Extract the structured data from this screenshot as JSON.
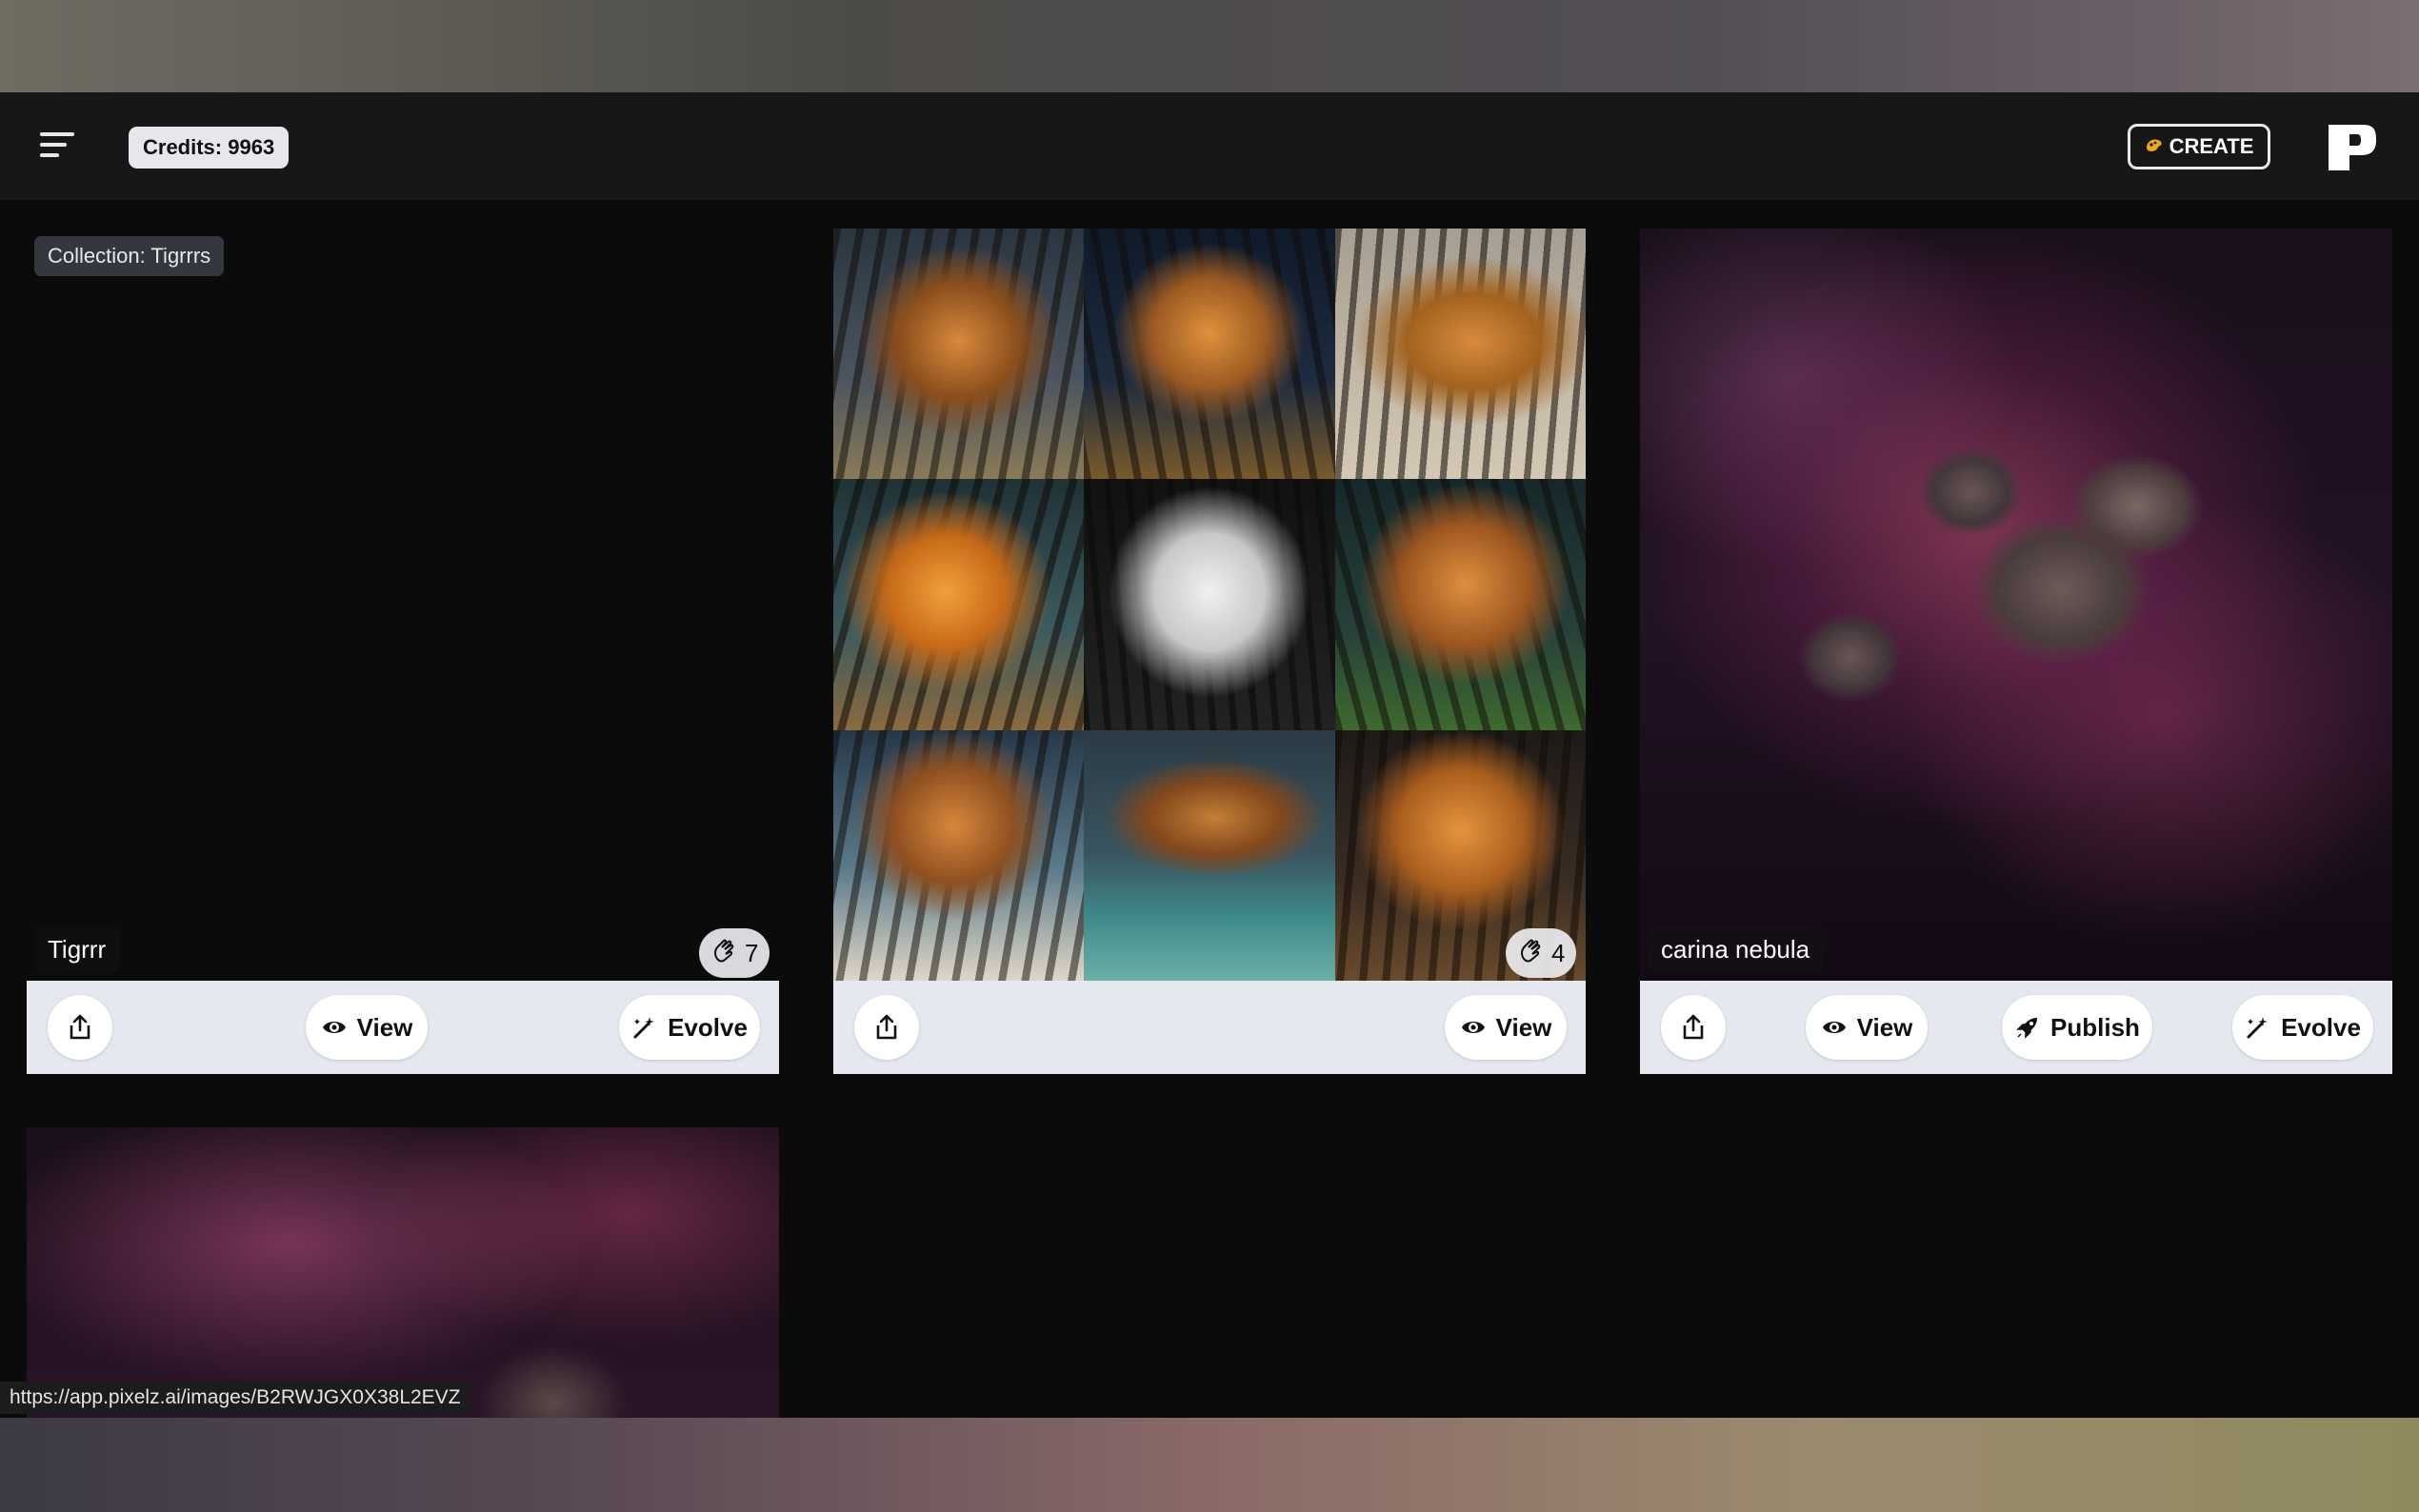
{
  "header": {
    "credits": "Credits: 9963",
    "create_label": "CREATE"
  },
  "cards": [
    {
      "collection_tag": "Collection: Tigrrrs",
      "title": "Tigrrr",
      "likes": "7",
      "actions": {
        "view": "View",
        "evolve": "Evolve"
      }
    },
    {
      "likes": "4",
      "actions": {
        "view": "View"
      }
    },
    {
      "title": "carina nebula",
      "actions": {
        "view": "View",
        "publish": "Publish",
        "evolve": "Evolve"
      }
    }
  ],
  "status_bar": {
    "url": "https://app.pixelz.ai/images/B2RWJGX0X38L2EVZ"
  },
  "colors": {
    "topbar": "#171718",
    "card_bar": "#e5e9ef",
    "create_icon": "#f0a81c"
  },
  "icons": [
    "menu-icon",
    "share-icon",
    "eye-icon",
    "magic-wand-icon",
    "rocket-icon",
    "clap-icon",
    "paint-icon",
    "logo-p-icon"
  ]
}
